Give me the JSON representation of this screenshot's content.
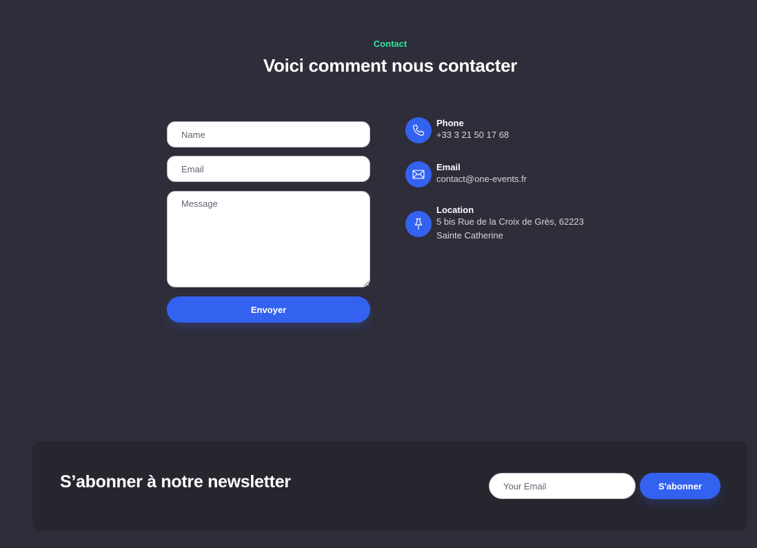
{
  "header": {
    "kicker": "Contact",
    "title": "Voici comment nous contacter"
  },
  "form": {
    "name_placeholder": "Name",
    "email_placeholder": "Email",
    "message_placeholder": "Message",
    "submit_label": "Envoyer"
  },
  "contact_info": {
    "phone": {
      "title": "Phone",
      "value": "+33 3 21 50 17 68",
      "icon": "phone-icon"
    },
    "email": {
      "title": "Email",
      "value": "contact@one-events.fr",
      "icon": "envelope-icon"
    },
    "location": {
      "title": "Location",
      "line1": "5 bis Rue de la Croix de Grès, 62223",
      "line2": "Sainte Catherine",
      "icon": "pin-icon"
    }
  },
  "newsletter": {
    "title": "S’abonner à notre newsletter",
    "email_placeholder": "Your Email",
    "button_label": "S'abonner"
  },
  "colors": {
    "background": "#2e2d39",
    "accent": "#3462f0",
    "kicker": "#2ee6a0",
    "panel": "#27262f"
  }
}
